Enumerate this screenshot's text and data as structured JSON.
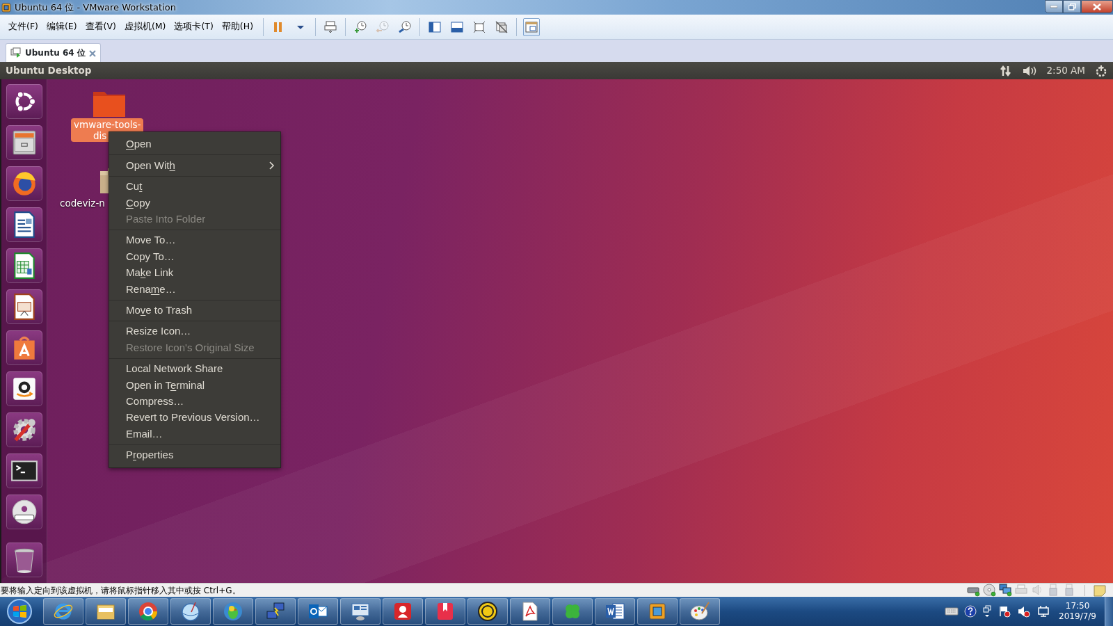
{
  "window": {
    "title": "Ubuntu 64 位 - VMware Workstation"
  },
  "menu_bar": [
    "文件(F)",
    "编辑(E)",
    "查看(V)",
    "虚拟机(M)",
    "选项卡(T)",
    "帮助(H)"
  ],
  "toolbar": [
    [
      {
        "kind": "pause",
        "disabled": false,
        "selected": false
      },
      {
        "kind": "dropdown",
        "disabled": false,
        "selected": false
      }
    ],
    [
      {
        "kind": "send_keys",
        "disabled": false,
        "selected": false
      }
    ],
    [
      {
        "kind": "snapshot_take",
        "disabled": false,
        "selected": false
      },
      {
        "kind": "snapshot_revert",
        "disabled": true,
        "selected": false
      },
      {
        "kind": "snapshot_manager",
        "disabled": false,
        "selected": false
      }
    ],
    [
      {
        "kind": "view_sidebar",
        "disabled": false,
        "selected": false
      },
      {
        "kind": "view_thumbs",
        "disabled": false,
        "selected": false
      },
      {
        "kind": "fullscreen",
        "disabled": false,
        "selected": false
      },
      {
        "kind": "unity",
        "disabled": false,
        "selected": false
      }
    ],
    [
      {
        "kind": "console_view",
        "disabled": false,
        "selected": true
      }
    ]
  ],
  "tabs": [
    {
      "label": "Ubuntu 64 位",
      "selected": true
    }
  ],
  "ubuntu_panel": {
    "title": "Ubuntu Desktop",
    "clock": "2:50 AM"
  },
  "launcher": [
    {
      "kind": "dash"
    },
    {
      "kind": "files"
    },
    {
      "kind": "browser"
    },
    {
      "kind": "writer"
    },
    {
      "kind": "calc"
    },
    {
      "kind": "impress"
    },
    {
      "kind": "software"
    },
    {
      "kind": "shop"
    },
    {
      "kind": "settings"
    },
    {
      "kind": "terminal"
    },
    {
      "kind": "dvd"
    },
    {
      "kind": "trash"
    }
  ],
  "desktop_icons": [
    {
      "kind": "folder",
      "label_lines": [
        "vmware-tools-",
        "dis"
      ],
      "selected": true
    },
    {
      "kind": "archive",
      "label_lines": [
        "codeviz-n"
      ],
      "selected": false
    }
  ],
  "context_menu": [
    [
      {
        "text": {
          "key": "O",
          "after": "pen"
        },
        "disabled": false,
        "submenu": false
      }
    ],
    [
      {
        "text": {
          "before": "Open Wit",
          "key": "h"
        },
        "disabled": false,
        "submenu": true
      }
    ],
    [
      {
        "text": {
          "before": "Cu",
          "key": "t"
        },
        "disabled": false,
        "submenu": false
      },
      {
        "text": {
          "key": "C",
          "after": "opy"
        },
        "disabled": false,
        "submenu": false
      },
      {
        "text": [
          "Paste Into Folder"
        ],
        "disabled": true,
        "submenu": false
      }
    ],
    [
      {
        "text": [
          "Move To…"
        ],
        "disabled": false,
        "submenu": false
      },
      {
        "text": [
          "Copy To…"
        ],
        "disabled": false,
        "submenu": false
      },
      {
        "text": [
          "Ma",
          "k",
          "e Link"
        ],
        "disabled": false,
        "submenu": false
      },
      {
        "text": [
          "Rena",
          "m",
          "e…"
        ],
        "disabled": false,
        "submenu": false
      }
    ],
    [
      {
        "text": [
          "Mo",
          "v",
          "e to Trash"
        ],
        "disabled": false,
        "submenu": false
      }
    ],
    [
      {
        "text": [
          "Resize Icon…"
        ],
        "disabled": false,
        "submenu": false
      },
      {
        "text": [
          "Restore Icon's Original Size"
        ],
        "disabled": true,
        "submenu": false
      }
    ],
    [
      {
        "text": [
          "Local Network Share"
        ],
        "disabled": false,
        "submenu": false
      },
      {
        "text": [
          "Open in T",
          "e",
          "rminal"
        ],
        "disabled": false,
        "submenu": false
      },
      {
        "text": [
          "Compress…"
        ],
        "disabled": false,
        "submenu": false
      },
      {
        "text": [
          "Revert to Previous Version…"
        ],
        "disabled": false,
        "submenu": false
      },
      {
        "text": [
          "Email…"
        ],
        "disabled": false,
        "submenu": false
      }
    ],
    [
      {
        "text": [
          "P",
          "r",
          "operties"
        ],
        "disabled": false,
        "submenu": false
      }
    ]
  ],
  "status_bar": {
    "message": "要将输入定向到该虚拟机，请将鼠标指针移入其中或按 Ctrl+G。",
    "devices": [
      {
        "kind": "hdd",
        "connected": true
      },
      {
        "kind": "cd",
        "connected": true
      },
      {
        "kind": "network",
        "connected": true
      },
      {
        "kind": "printer",
        "connected": false
      },
      {
        "kind": "sound",
        "connected": false
      },
      {
        "kind": "usb",
        "connected": false
      },
      {
        "kind": "usb",
        "connected": false
      }
    ]
  },
  "taskbar": {
    "apps": [
      {
        "kind": "ie"
      },
      {
        "kind": "explorer"
      },
      {
        "kind": "chrome"
      },
      {
        "kind": "sphere"
      },
      {
        "kind": "bird"
      },
      {
        "kind": "netpc"
      },
      {
        "kind": "mail"
      },
      {
        "kind": "remote"
      },
      {
        "kind": "reader"
      },
      {
        "kind": "bookmark"
      },
      {
        "kind": "ue"
      },
      {
        "kind": "pdf"
      },
      {
        "kind": "clover"
      },
      {
        "kind": "word"
      },
      {
        "kind": "vm"
      },
      {
        "kind": "paint"
      }
    ],
    "time": "17:50",
    "date": "2019/7/9"
  }
}
